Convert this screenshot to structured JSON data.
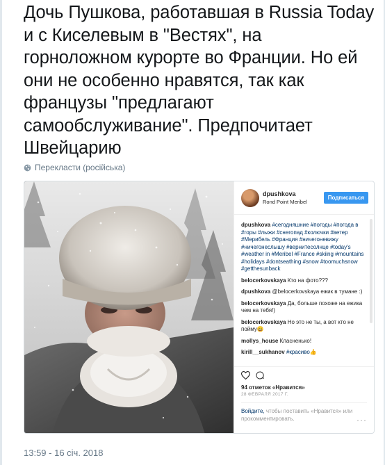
{
  "tweet": {
    "text": "Дочь Пушкова, работавшая в Russia Today и с Киселевым в \"Вестях\", на горноложном курорте во Франции. Но ей они не особенно нравятся, так как французы \"предлагают самообслуживание\". Предпочитает Швейцарию",
    "translate_label": "Перекласти (російська)",
    "timestamp": "13:59 - 16 січ. 2018"
  },
  "instagram": {
    "username": "dpushkova",
    "location": "Rond Point Meribel",
    "follow_label": "Подписаться",
    "caption": {
      "user": "dpushkova",
      "text": "#сегодняшние #погоды #погода в #горы #лыжи #снегопад #колючки #ветер #Мерибель #Франция #ничегоневижу #ничегонеслышу #вернитесолнце #today's #weather in #Meribel #France #skiing #mountains #holidays #dontseathing #snow #toomuchsnow #getthesunback"
    },
    "comments": [
      {
        "user": "belocerkovskaya",
        "text": "Кто на фото???"
      },
      {
        "user": "dpushkova",
        "text": "@belocerkovskaya ежик в тумане :)"
      },
      {
        "user": "belocerkovskaya",
        "text": "Да, больше похоже на ежика чем на тебя!)"
      },
      {
        "user": "belocerkovskaya",
        "text": "Но это не ты, а вот кто не пойму😀"
      },
      {
        "user": "mollys_house",
        "text": "Класненько!"
      },
      {
        "user": "kirill__sukhanov",
        "text": "#красиво👍"
      }
    ],
    "likes": "94 отметок «Нравится»",
    "date": "28 ФЕВРАЛЯ 2017 Г.",
    "login_prompt": {
      "link": "Войдите,",
      "rest": " чтобы поставить «Нравится» или прокомментировать."
    },
    "more_label": "···"
  },
  "icons": [
    "globe-icon",
    "heart-icon",
    "comment-icon"
  ],
  "colors": {
    "link_blue": "#3897f0",
    "tag_blue": "#003569",
    "meta_gray": "#657786"
  }
}
